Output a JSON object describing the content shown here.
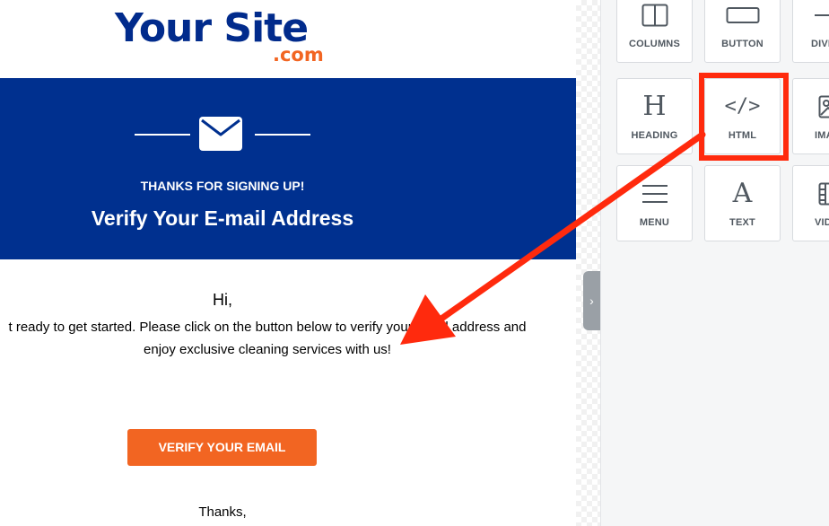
{
  "email": {
    "logo": {
      "main": "Your Site",
      "sub": ".com"
    },
    "banner": {
      "kicker": "THANKS FOR SIGNING UP!",
      "title": "Verify Your E-mail Address"
    },
    "greeting": "Hi,",
    "message_line1": "t ready to get started. Please click on the button below to verify your email address and",
    "message_line2": "enjoy exclusive cleaning services with us!",
    "cta_label": "VERIFY YOUR EMAIL",
    "signoff": "Thanks,"
  },
  "tools": {
    "columns": {
      "label": "COLUMNS",
      "icon": "columns-icon"
    },
    "button": {
      "label": "BUTTON",
      "icon": "button-icon"
    },
    "divider": {
      "label": "DIVI",
      "icon": "divider-icon"
    },
    "heading": {
      "label": "HEADING",
      "icon": "heading-icon",
      "glyph": "H"
    },
    "html": {
      "label": "HTML",
      "icon": "code-icon",
      "glyph": "</>"
    },
    "image": {
      "label": "IMA",
      "icon": "image-icon"
    },
    "menu": {
      "label": "MENU",
      "icon": "menu-icon"
    },
    "text": {
      "label": "TEXT",
      "icon": "text-icon",
      "glyph": "A"
    },
    "video": {
      "label": "VID",
      "icon": "video-icon"
    }
  },
  "colors": {
    "brand_blue": "#00308f",
    "brand_orange": "#f26522",
    "annotation_red": "#ff2a0d"
  }
}
